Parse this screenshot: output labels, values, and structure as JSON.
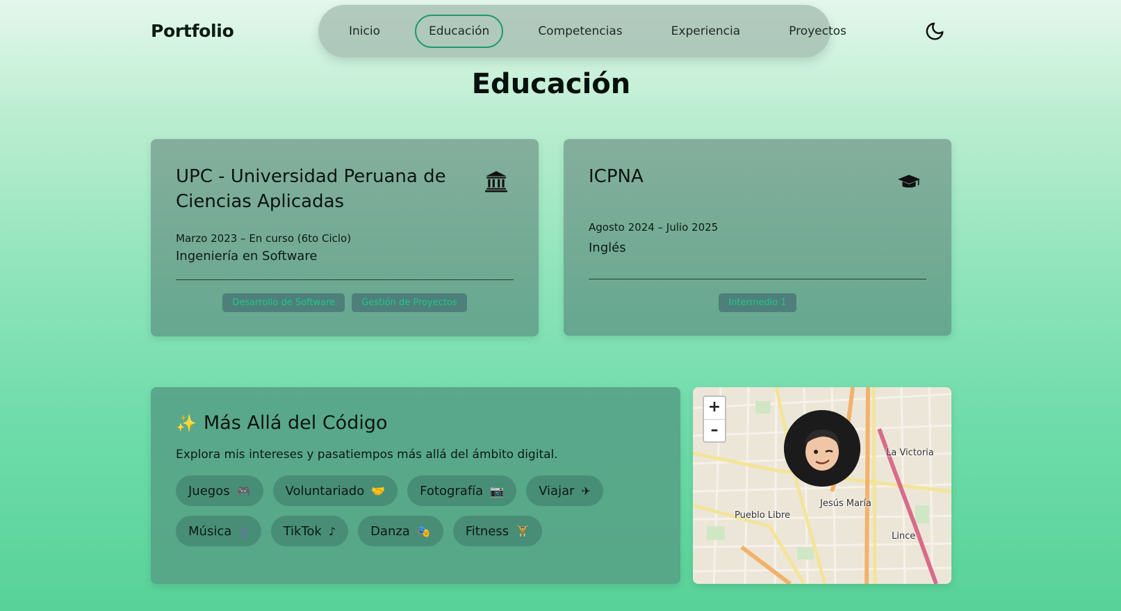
{
  "brand": "Portfolio",
  "nav": {
    "items": [
      "Inicio",
      "Educación",
      "Competencias",
      "Experiencia",
      "Proyectos"
    ],
    "active": "Educación"
  },
  "theme_toggle": {
    "icon": "moon-icon"
  },
  "section_title": "Educación",
  "education": [
    {
      "institution": "UPC - Universidad Peruana de Ciencias Aplicadas",
      "icon": "university-icon",
      "dates": "Marzo 2023 – En curso (6to Ciclo)",
      "degree": "Ingeniería en Software",
      "tags": [
        "Desarrollo de Software",
        "Gestión de Proyectos"
      ]
    },
    {
      "institution": "ICPNA",
      "icon": "graduation-cap-icon",
      "dates": "Agosto 2024 – Julio 2025",
      "degree": "Inglés",
      "tags": [
        "Intermedio 1"
      ]
    }
  ],
  "beyond": {
    "title": "Más Allá del Código",
    "title_icon": "sparkles-icon",
    "description": "Explora mis intereses y pasatiempos más allá del ámbito digital.",
    "hobbies": [
      {
        "label": "Juegos",
        "icon": "gamepad-icon"
      },
      {
        "label": "Voluntariado",
        "icon": "handshake-icon"
      },
      {
        "label": "Fotografía",
        "icon": "camera-icon"
      },
      {
        "label": "Viajar",
        "icon": "plane-icon"
      },
      {
        "label": "Música",
        "icon": "music-icon"
      },
      {
        "label": "TikTok",
        "icon": "tiktok-icon"
      },
      {
        "label": "Danza",
        "icon": "masks-icon"
      },
      {
        "label": "Fitness",
        "icon": "dumbbell-icon"
      }
    ]
  },
  "map": {
    "zoom_in": "+",
    "zoom_out": "–",
    "labels": [
      "La Victoria",
      "Pueblo Libre",
      "Jesús María",
      "Lince"
    ]
  }
}
